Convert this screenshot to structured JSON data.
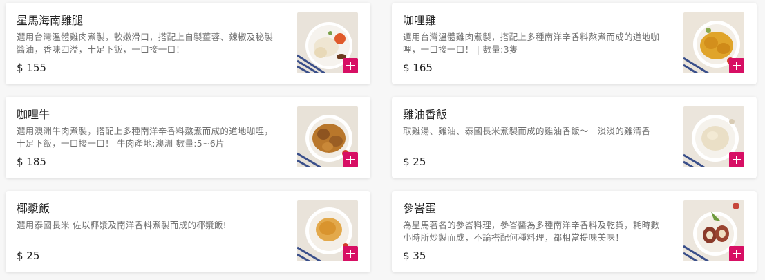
{
  "menu": {
    "items": [
      {
        "name": "星馬海南雞腿",
        "description": "選用台灣溫體雞肉煮製，軟嫩滑口，搭配上自製薑蓉、辣椒及秘製醬油，香味四溢，十足下飯，一口接一口！",
        "price": "$ 155",
        "image_icon": "hainanese-chicken-leg-image",
        "add_icon": "plus-icon"
      },
      {
        "name": "咖哩雞",
        "description": "選用台灣溫體雞肉煮製，搭配上多種南洋辛香料熬煮而成的道地咖哩，一口接一口！ | 數量:3隻",
        "price": "$ 165",
        "image_icon": "curry-chicken-image",
        "add_icon": "plus-icon"
      },
      {
        "name": "咖哩牛",
        "description": "選用澳洲牛肉煮製，搭配上多種南洋辛香料熬煮而成的道地咖哩，十足下飯，一口接一口！ 牛肉產地:澳洲 數量:5~6片",
        "price": "$ 185",
        "image_icon": "curry-beef-image",
        "add_icon": "plus-icon"
      },
      {
        "name": "雞油香飯",
        "description": "取雞湯、雞油、泰國長米煮製而成的雞油香飯～　淡淡的雞清香",
        "price": "$ 25",
        "image_icon": "chicken-oil-rice-image",
        "add_icon": "plus-icon"
      },
      {
        "name": "椰漿飯",
        "description": "選用泰國長米 佐以椰漿及南洋香料煮製而成的椰漿飯!",
        "price": "$ 25",
        "image_icon": "coconut-rice-image",
        "add_icon": "plus-icon"
      },
      {
        "name": "參峇蛋",
        "description": "為星馬著名的參峇料理，參峇醬為多種南洋辛香料及乾貨，耗時數小時所炒製而成，不論搭配何種料理，都相當提味美味！",
        "price": "$ 35",
        "image_icon": "sambal-egg-image",
        "add_icon": "plus-icon"
      }
    ]
  },
  "colors": {
    "accent": "#d70f64",
    "background": "#f7f7f7",
    "card": "#ffffff",
    "title_text": "#222222",
    "desc_text": "#707070"
  }
}
